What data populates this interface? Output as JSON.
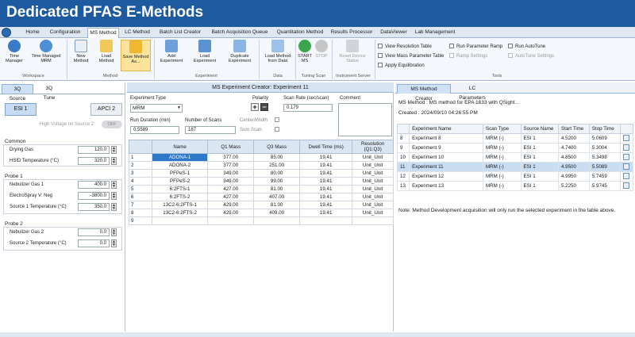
{
  "banner": {
    "title": "Dedicated PFAS E-Methods"
  },
  "menu_tabs": [
    "Home",
    "Configuration",
    "MS Method",
    "LC Method",
    "Batch List Creator",
    "Batch Acquisition Queue",
    "Quantitation Method",
    "Results Processor",
    "DataViewer",
    "Lab Management"
  ],
  "ribbon": {
    "buttons": [
      {
        "label": "Time\nManager"
      },
      {
        "label": "Time Managed\nMRM"
      },
      {
        "label": "New\nMethod"
      },
      {
        "label": "Load\nMethod"
      },
      {
        "label": "Save Method\nAs..."
      },
      {
        "label": "Add\nExperiment"
      },
      {
        "label": "Load\nExperiment"
      },
      {
        "label": "Duplicate\nExperiment"
      },
      {
        "label": "Load Method\nfrom Data"
      },
      {
        "label": "START\nMS"
      },
      {
        "label": "STOP"
      },
      {
        "label": "Reset Device\nStatus"
      }
    ],
    "groups": [
      "Workspace",
      "Method",
      "Experiment",
      "Data",
      "Tuning Scan",
      "Instrument Server",
      "Tools"
    ],
    "checks": [
      "View Resolution Table",
      "View Mass Parameter Table",
      "Apply Equilibration",
      "Run Parameter Ramp",
      "Ramp Settings",
      "Run AutoTune",
      "AutoTune Settings"
    ]
  },
  "left": {
    "tabs": [
      "3Q Source",
      "3Q Tune"
    ],
    "esi1": "ESI 1",
    "apci2": "APCI 2",
    "hv_label": "High Voltage on Source 2:",
    "hv_toggle": "OFF",
    "common_title": "Common",
    "common": [
      {
        "label": "Drying Gas",
        "value": "120.0"
      },
      {
        "label": "HSID Temperature (°C)",
        "value": "320.0"
      }
    ],
    "probe1_title": "Probe 1",
    "probe1": [
      {
        "label": "Nebulizer Gas 1",
        "value": "400.0"
      },
      {
        "label": "ElectroSpray V: Neg",
        "value": "-3800.0"
      },
      {
        "label": "Source 1 Temperature (°C)",
        "value": "350.0"
      }
    ],
    "probe2_title": "Probe 2",
    "probe2": [
      {
        "label": "Nebulizer Gas 2",
        "value": "0.0"
      },
      {
        "label": "Source 2 Temperature (°C)",
        "value": "0.0"
      }
    ]
  },
  "center": {
    "title": "MS Experiment Creator: Experiment 11",
    "exp_type_label": "Experiment Type",
    "exp_type_value": "MRM",
    "polarity_label": "Polarity",
    "scan_rate_label": "Scan Rate (sec/scan)",
    "scan_rate_value": "0.179",
    "comment_label": "Comment",
    "run_dur_label": "Run Duration (min)",
    "run_dur_value": "0.5589",
    "num_scans_label": "Number of Scans",
    "num_scans_value": "187",
    "center_width": "Center/Width",
    "sum_scan": "Sum Scan",
    "headers": [
      "Name",
      "Q1 Mass",
      "Q3 Mass",
      "Dwell Time (ms)",
      "Resolution\n(Q1:Q3)"
    ],
    "rows": [
      [
        "1",
        "ADONA-1",
        "377.00",
        "85.00",
        "19.41",
        "Unit_Unit"
      ],
      [
        "2",
        "ADONA-2",
        "377.00",
        "251.00",
        "19.41",
        "Unit_Unit"
      ],
      [
        "3",
        "PFPeS-1",
        "349.00",
        "80.00",
        "19.41",
        "Unit_Unit"
      ],
      [
        "4",
        "PFPeS-2",
        "349.00",
        "99.00",
        "19.41",
        "Unit_Unit"
      ],
      [
        "5",
        "6:2FTS-1",
        "427.00",
        "81.00",
        "19.41",
        "Unit_Unit"
      ],
      [
        "6",
        "6:2FTS-2",
        "427.00",
        "407.00",
        "19.41",
        "Unit_Unit"
      ],
      [
        "7",
        "13C2-6:2FTS-1",
        "429.00",
        "81.00",
        "19.41",
        "Unit_Unit"
      ],
      [
        "8",
        "13C2-6:2FTS-2",
        "429.00",
        "409.00",
        "19.41",
        "Unit_Unit"
      ],
      [
        "9",
        "",
        "",
        "",
        "",
        ""
      ]
    ]
  },
  "right": {
    "tabs": [
      "MS Method Creator",
      "LC Parameters"
    ],
    "method_line": "MS Method : MS method for EPA 1633 with QSight...",
    "created_line": "Created : 2024/09/10 04:26:55 PM",
    "headers": [
      "",
      "Experiment Name",
      "Scan Type",
      "Source Name",
      "Start Time",
      "Stop Time",
      ""
    ],
    "rows": [
      [
        "8",
        "Experiment 8",
        "MRM (-)",
        "ESI 1",
        "4.5200",
        "5.0609"
      ],
      [
        "9",
        "Experiment 9",
        "MRM (-)",
        "ESI 1",
        "4.7400",
        "5.3004"
      ],
      [
        "10",
        "Experiment 10",
        "MRM (-)",
        "ESI 1",
        "4.8500",
        "5.3498"
      ],
      [
        "11",
        "Experiment 11",
        "MRM (-)",
        "ESI 1",
        "4.9500",
        "5.5089"
      ],
      [
        "12",
        "Experiment 12",
        "MRM (-)",
        "ESI 1",
        "4.9950",
        "5.7459"
      ],
      [
        "13",
        "Experiment 13",
        "MRM (-)",
        "ESI 1",
        "5.2250",
        "5.9745"
      ]
    ],
    "note": "Note: Method Development acquisition will only run the selected experiment in the table above."
  },
  "colors": {
    "banner": "#1d5aa0",
    "selection": "#2e78c8",
    "highlight": "#fbe39b"
  }
}
